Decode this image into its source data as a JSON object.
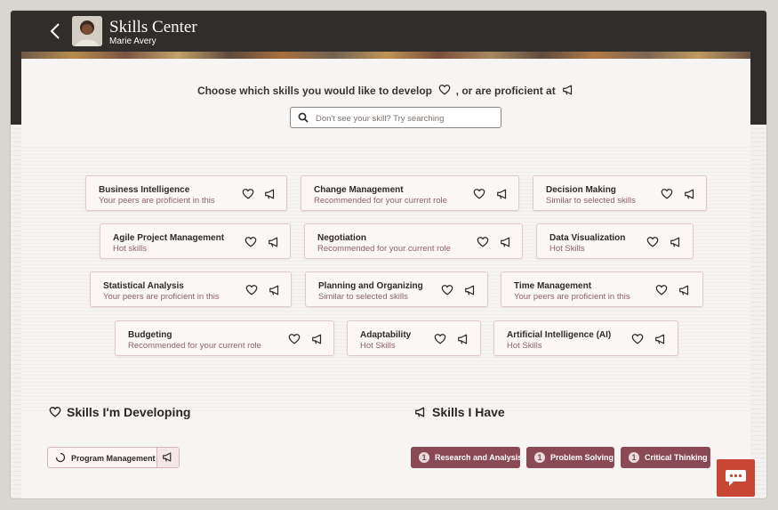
{
  "header": {
    "title": "Skills Center",
    "user_name": "Marie Avery"
  },
  "prompt": {
    "text_a": "Choose which skills you would like to develop",
    "text_b": ", or are proficient at"
  },
  "search": {
    "placeholder": "Don't see your skill? Try searching"
  },
  "skill_cards": [
    {
      "name": "Business Intelligence",
      "reason": "Your peers are proficient in this"
    },
    {
      "name": "Change Management",
      "reason": "Recommended for your current role"
    },
    {
      "name": "Decision Making",
      "reason": "Similar to selected skills"
    },
    {
      "name": "Agile Project Management",
      "reason": "Hot skills"
    },
    {
      "name": "Negotiation",
      "reason": "Recommended for your current role"
    },
    {
      "name": "Data Visualization",
      "reason": "Hot Skills"
    },
    {
      "name": "Statistical Analysis",
      "reason": "Your peers are proficient in this"
    },
    {
      "name": "Planning and Organizing",
      "reason": "Similar to selected skills"
    },
    {
      "name": "Time Management",
      "reason": "Your peers are proficient in this"
    },
    {
      "name": "Budgeting",
      "reason": "Recommended for your current role"
    },
    {
      "name": "Adaptability",
      "reason": "Hot Skills"
    },
    {
      "name": "Artificial Intelligence (AI)",
      "reason": "Hot Skills"
    }
  ],
  "developing": {
    "heading": "Skills I'm Developing",
    "items": [
      "Program Management"
    ]
  },
  "have": {
    "heading": "Skills I Have",
    "items": [
      {
        "label": "Research and Analysis",
        "badge": "1"
      },
      {
        "label": "Problem Solving",
        "badge": "1"
      },
      {
        "label": "Critical Thinking",
        "badge": "1"
      }
    ]
  },
  "colors": {
    "header_bg": "#312d2a",
    "accent": "#8a4a55",
    "chat_button": "#c74634"
  },
  "icons": {
    "develop": "heart-icon",
    "proficient": "megaphone-icon",
    "back": "chevron-left-icon",
    "search": "search-icon",
    "chat": "chat-icon"
  }
}
